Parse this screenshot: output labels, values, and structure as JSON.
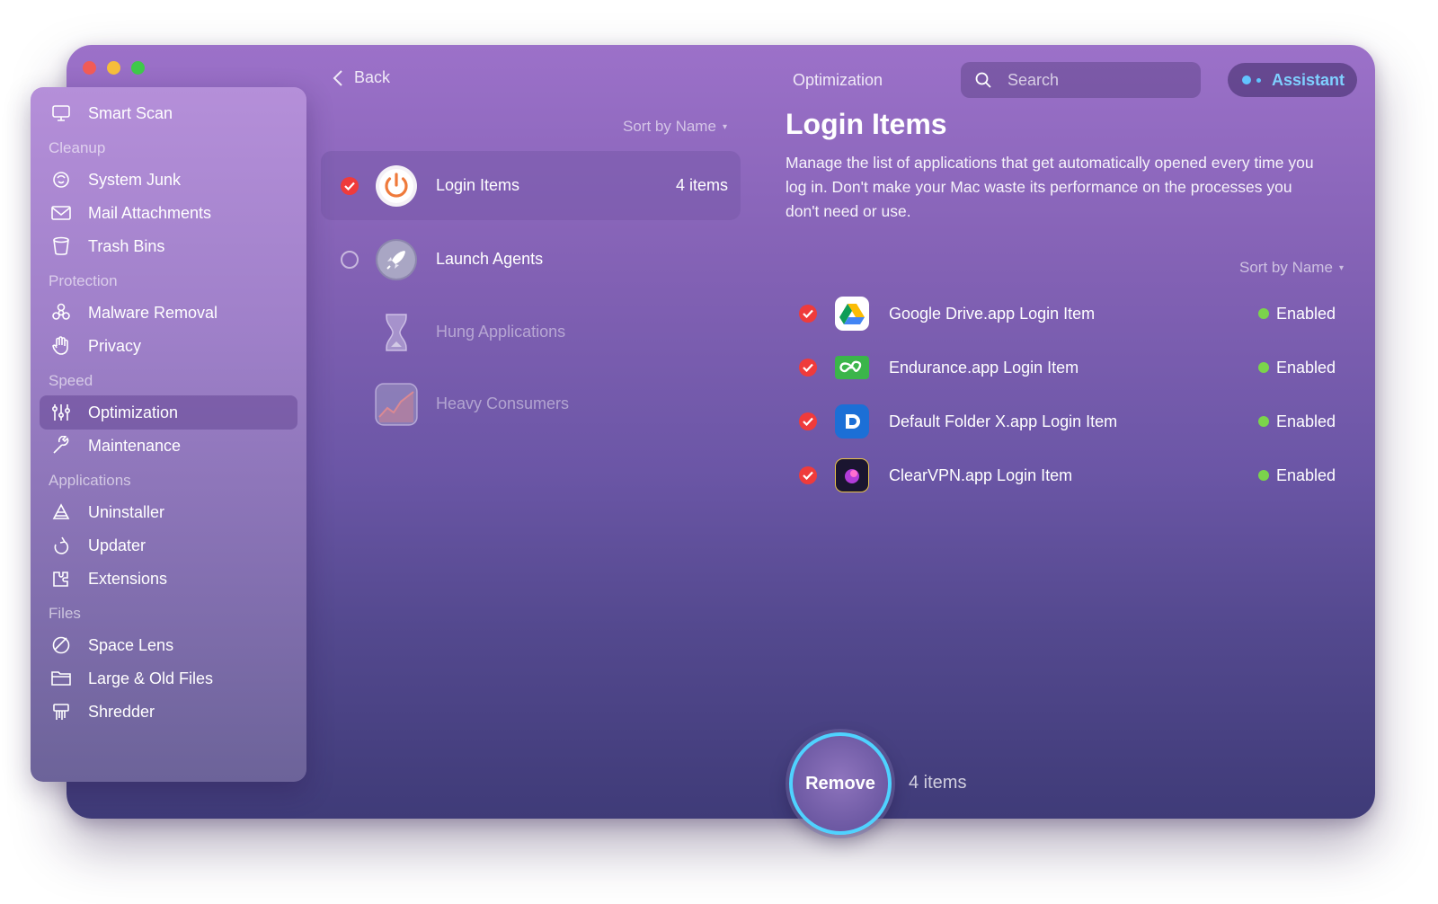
{
  "topbar": {
    "back_label": "Back",
    "section_title": "Optimization",
    "search_placeholder": "Search",
    "assistant_label": "Assistant"
  },
  "sidebar": {
    "top_item": {
      "label": "Smart Scan",
      "icon": "monitor-icon"
    },
    "sections": [
      {
        "title": "Cleanup",
        "items": [
          {
            "label": "System Junk",
            "icon": "junk-icon"
          },
          {
            "label": "Mail Attachments",
            "icon": "mail-icon"
          },
          {
            "label": "Trash Bins",
            "icon": "trash-icon"
          }
        ]
      },
      {
        "title": "Protection",
        "items": [
          {
            "label": "Malware Removal",
            "icon": "biohazard-icon"
          },
          {
            "label": "Privacy",
            "icon": "hand-icon"
          }
        ]
      },
      {
        "title": "Speed",
        "items": [
          {
            "label": "Optimization",
            "icon": "sliders-icon",
            "active": true
          },
          {
            "label": "Maintenance",
            "icon": "wrench-icon"
          }
        ]
      },
      {
        "title": "Applications",
        "items": [
          {
            "label": "Uninstaller",
            "icon": "uninstaller-icon"
          },
          {
            "label": "Updater",
            "icon": "updater-icon"
          },
          {
            "label": "Extensions",
            "icon": "extensions-icon"
          }
        ]
      },
      {
        "title": "Files",
        "items": [
          {
            "label": "Space Lens",
            "icon": "lens-icon"
          },
          {
            "label": "Large & Old Files",
            "icon": "folder-icon"
          },
          {
            "label": "Shredder",
            "icon": "shredder-icon"
          }
        ]
      }
    ]
  },
  "middle": {
    "sort_label": "Sort by Name",
    "categories": [
      {
        "label": "Login Items",
        "count": "4 items",
        "selected": true,
        "checked": true,
        "icon": "power-icon"
      },
      {
        "label": "Launch Agents",
        "count": "",
        "selected": false,
        "checked": false,
        "icon": "rocket-icon"
      },
      {
        "label": "Hung Applications",
        "count": "",
        "selected": false,
        "disabled": true,
        "icon": "hourglass-icon"
      },
      {
        "label": "Heavy Consumers",
        "count": "",
        "selected": false,
        "disabled": true,
        "icon": "chart-icon"
      }
    ]
  },
  "detail": {
    "title": "Login Items",
    "description": "Manage the list of applications that get automatically opened every time you log in. Don't make your Mac waste its performance on the processes you don't need or use.",
    "sort_label": "Sort by Name",
    "items": [
      {
        "name": "Google Drive.app Login Item",
        "status": "Enabled",
        "icon": "google-drive-icon",
        "checked": true
      },
      {
        "name": "Endurance.app Login Item",
        "status": "Enabled",
        "icon": "endurance-icon",
        "checked": true
      },
      {
        "name": "Default Folder X.app Login Item",
        "status": "Enabled",
        "icon": "default-folder-icon",
        "checked": true
      },
      {
        "name": "ClearVPN.app Login Item",
        "status": "Enabled",
        "icon": "clearvpn-icon",
        "checked": true
      }
    ]
  },
  "footer": {
    "remove_label": "Remove",
    "count_label": "4 items"
  },
  "colors": {
    "accent_check": "#ef3b3b",
    "enabled_dot": "#7bd44b",
    "assistant_text": "#7fd0ff",
    "remove_ring": "#4fd2ff"
  }
}
